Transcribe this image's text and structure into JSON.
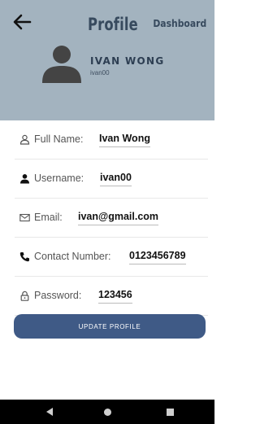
{
  "header": {
    "title": "Profile",
    "dashboard_label": "Dashboard",
    "display_name": "IVAN WONG",
    "username": "ivan00",
    "background_color": "#a3b3bf"
  },
  "fields": [
    {
      "label": "Full Name:",
      "value": "Ivan Wong",
      "icon": "person-outline-icon"
    },
    {
      "label": "Username:",
      "value": "ivan00",
      "icon": "person-filled-icon"
    },
    {
      "label": "Email:",
      "value": "ivan@gmail.com",
      "icon": "mail-icon"
    },
    {
      "label": "Contact Number:",
      "value": "0123456789",
      "icon": "phone-icon"
    },
    {
      "label": "Password:",
      "value": "123456",
      "icon": "lock-icon"
    }
  ],
  "actions": {
    "update_label": "UPDATE PROFILE",
    "button_color": "#3f5a86"
  },
  "navbar": {
    "icons": [
      "nav-back-icon",
      "nav-home-icon",
      "nav-recent-icon"
    ]
  }
}
